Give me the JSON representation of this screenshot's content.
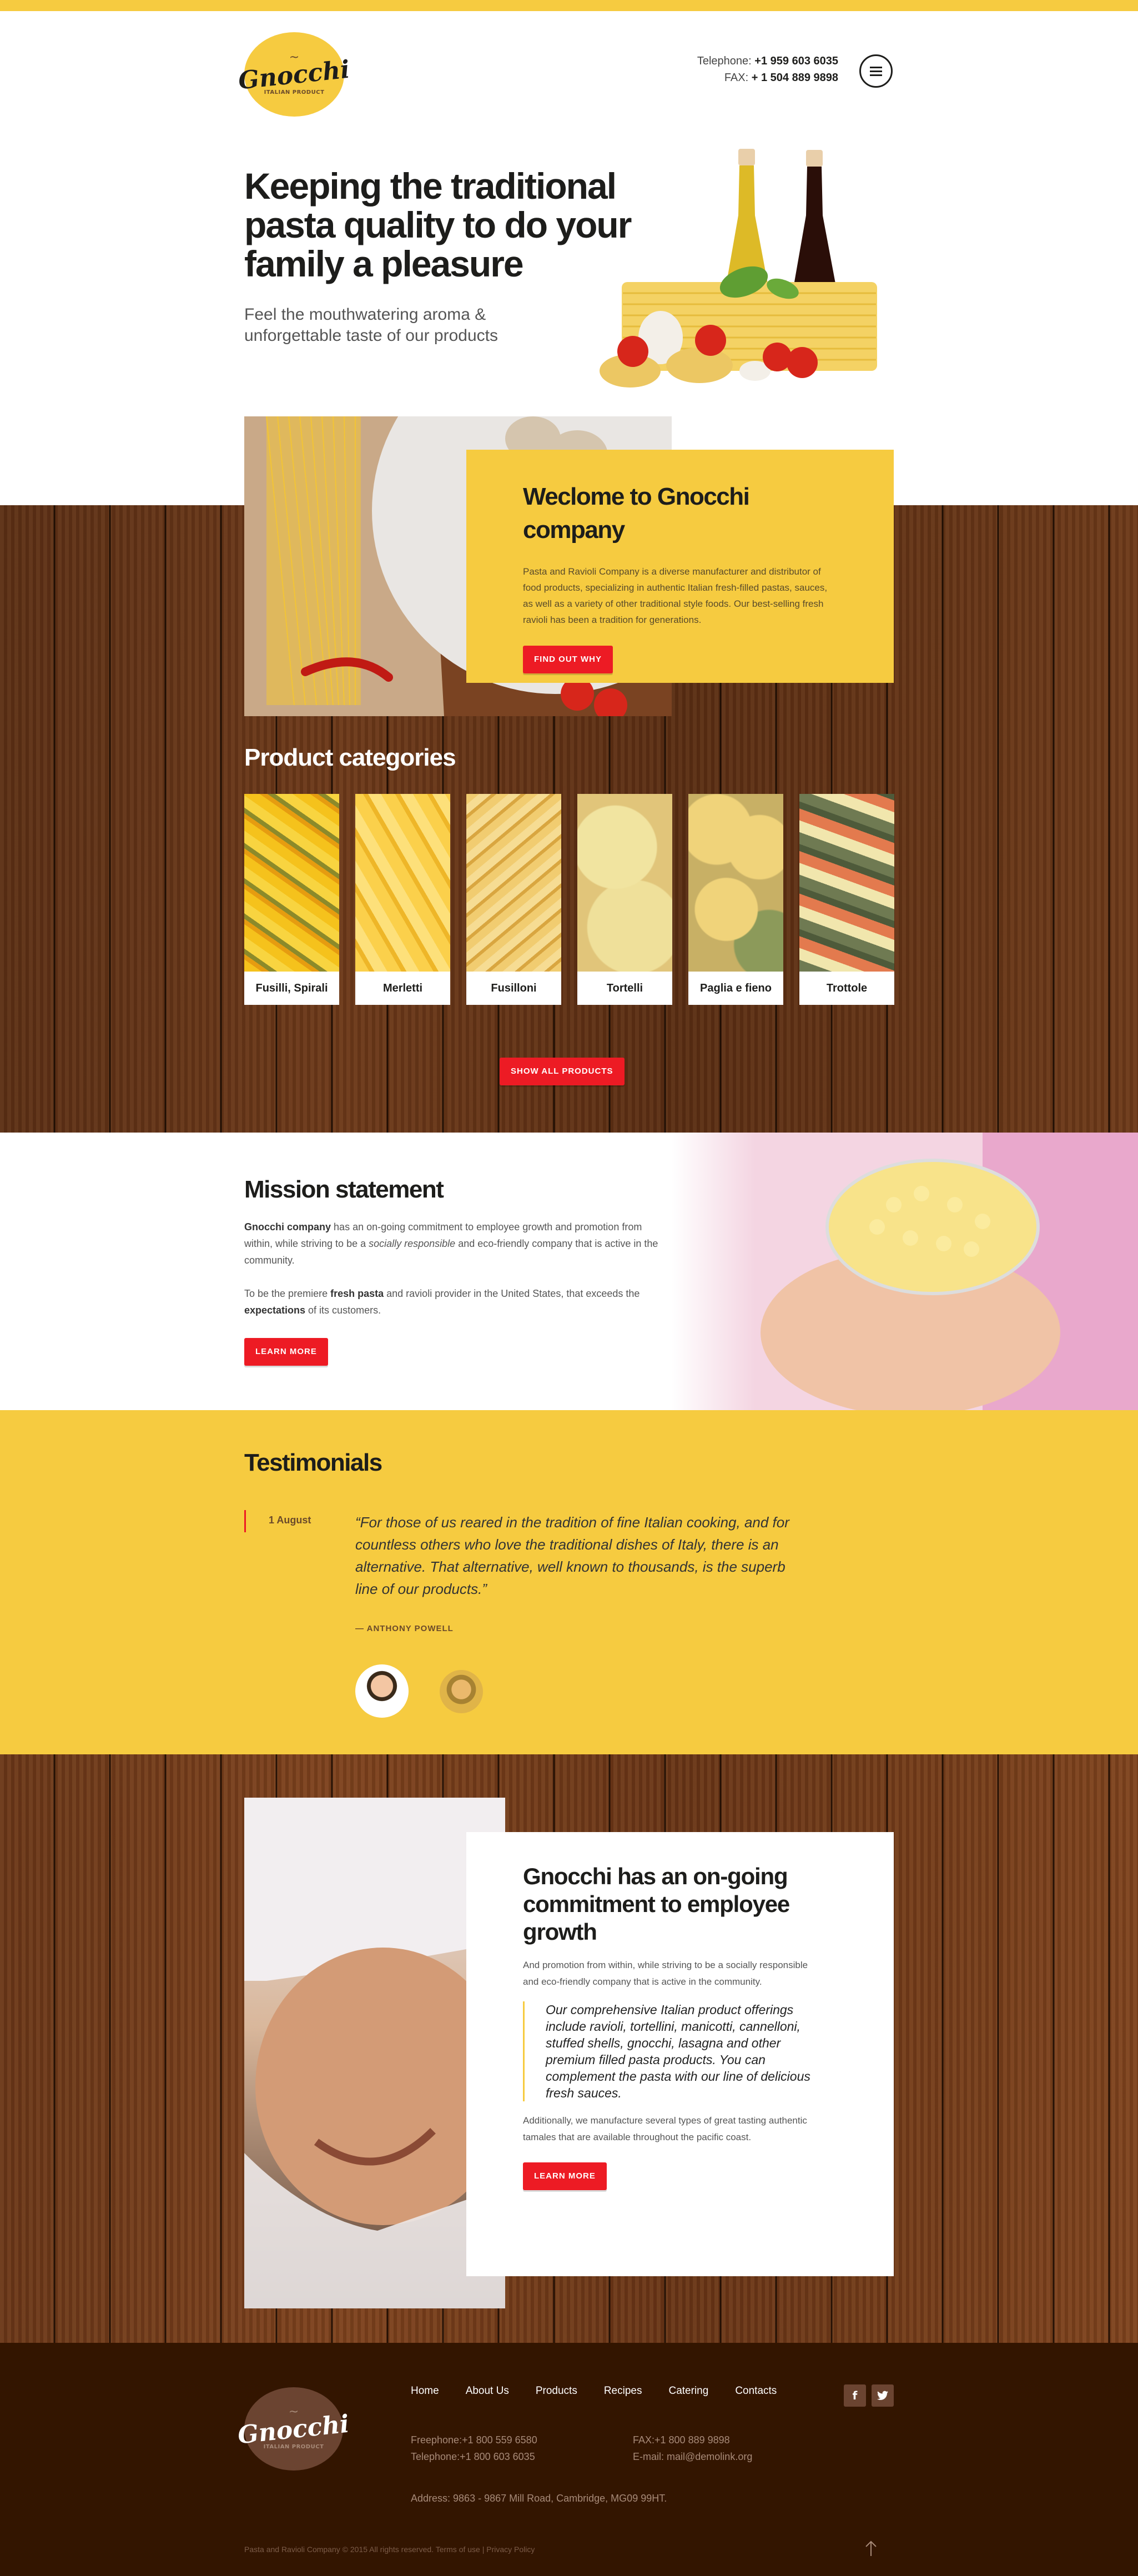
{
  "colors": {
    "accent_yellow": "#f6cb40",
    "accent_red": "#ed1b24",
    "footer_brown": "#331500",
    "dark_text": "#1d1d1b"
  },
  "header": {
    "logo": {
      "word": "Gnocchi",
      "tilde": "~",
      "tagline": "ITALIAN PRODUCT"
    },
    "telephone_label": "Telephone:",
    "telephone_value": "+1 959 603 6035",
    "fax_label": "FAX:",
    "fax_value": "+ 1 504 889 9898",
    "menu_icon": "hamburger-menu-icon"
  },
  "hero": {
    "title": "Keeping the traditional pasta quality to do your family a pleasure",
    "subtitle": "Feel the mouthwatering aroma & unforgettable taste of our products",
    "image": "pasta-oil-bottles-tomatoes-garlic"
  },
  "welcome": {
    "title": "Weclome to Gnocchi company",
    "text": "Pasta and Ravioli Company is a diverse manufacturer and distributor of food products, specializing in authentic Italian fresh-filled pastas, sauces, as well as a variety of other traditional style foods. Our best-selling fresh ravioli has been a tradition for generations.",
    "button": "FIND OUT WHY",
    "image": "spaghetti-clams-chili"
  },
  "products": {
    "title": "Product categories",
    "items": [
      {
        "label": "Fusilli, Spirali"
      },
      {
        "label": "Merletti"
      },
      {
        "label": "Fusilloni"
      },
      {
        "label": "Tortelli"
      },
      {
        "label": "Paglia e fieno"
      },
      {
        "label": "Trottole"
      }
    ],
    "button": "SHOW ALL PRODUCTS"
  },
  "mission": {
    "title": "Mission statement",
    "p1_bold": "Gnocchi company",
    "p1_a": " has an on-going commitment to employee growth and promotion from within, while striving to be a ",
    "p1_italic": "socially responsible",
    "p1_b": " and eco-friendly company that is active in the community.",
    "p2_a": "To be the premiere ",
    "p2_bold1": "fresh pasta",
    "p2_b": " and ravioli provider in the United States, that exceeds the ",
    "p2_bold2": "expectations",
    "p2_c": " of its customers.",
    "button": "LEARN MORE",
    "image": "hands-holding-macaroni-bowl"
  },
  "testimonials": {
    "title": "Testimonials",
    "date": "1 August",
    "quote": "“For those of us reared in the tradition of fine Italian cooking, and for countless others who love the traditional dishes of Italy, there is an alternative. That alternative, well known to thousands, is the superb line of our products.”",
    "author": "— ANTHONY POWELL",
    "avatars": [
      "avatar-man-smiling",
      "avatar-woman-glasses"
    ]
  },
  "commitment": {
    "title": "Gnocchi has an on-going commitment to employee growth",
    "p1": "And promotion from within, while striving to be a socially responsible and eco-friendly company that is active in the community.",
    "quote": "Our comprehensive Italian product offerings include ravioli, tortellini, manicotti, cannelloni, stuffed shells, gnocchi, lasagna and other premium filled pasta products. You can complement the pasta with our line of delicious fresh sauces.",
    "p2": "Additionally, we manufacture several types of great tasting authentic tamales that are available throughout the pacific coast.",
    "button": "LEARN MORE",
    "image": "smiling-chef"
  },
  "footer": {
    "nav": [
      "Home",
      "About Us",
      "Products",
      "Recipes",
      "Catering",
      "Contacts"
    ],
    "social": {
      "facebook": "f",
      "twitter": "t"
    },
    "freephone": "Freephone:+1 800 559 6580",
    "telephone": "Telephone:+1 800 603 6035",
    "fax": "FAX:+1 800 889 9898",
    "email": "E-mail: mail@demolink.org",
    "address": "Address: 9863 - 9867 Mill Road, Cambridge, MG09 99HT.",
    "copyright": "Pasta and Ravioli Company © 2015 All rights reserved.",
    "terms": "Terms of use",
    "separator": "|",
    "privacy": "Privacy Policy"
  }
}
